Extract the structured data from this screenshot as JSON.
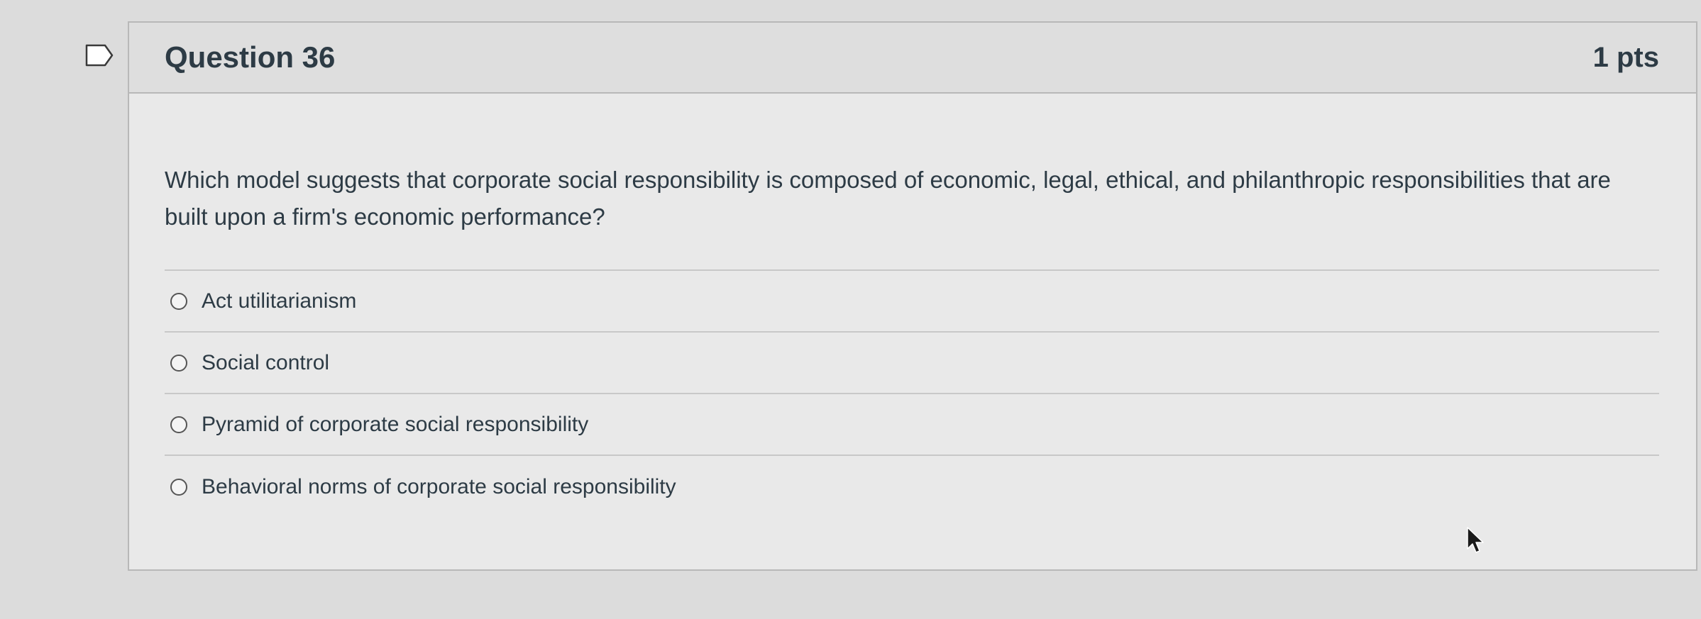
{
  "question": {
    "title": "Question 36",
    "points": "1 pts",
    "text": "Which model suggests that corporate social responsibility is composed of economic, legal, ethical, and philanthropic responsibilities that are built upon a firm's economic performance?",
    "answers": [
      {
        "label": "Act utilitarianism"
      },
      {
        "label": "Social control"
      },
      {
        "label": "Pyramid of corporate social responsibility"
      },
      {
        "label": "Behavioral norms of corporate social responsibility"
      }
    ]
  },
  "icons": {
    "flag": "flag-icon",
    "cursor": "mouse-pointer-icon"
  }
}
